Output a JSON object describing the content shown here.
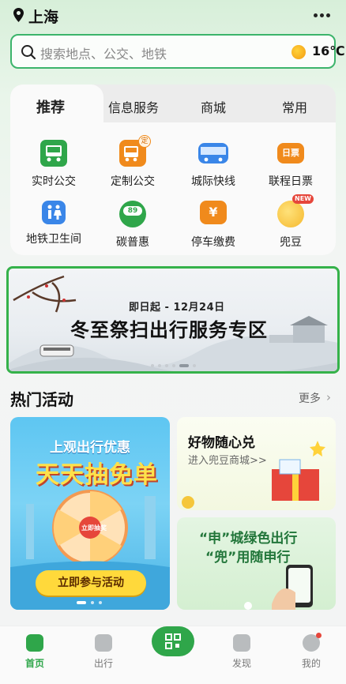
{
  "header": {
    "city": "上海"
  },
  "search": {
    "placeholder": "搜索地点、公交、地铁",
    "temperature": "16℃"
  },
  "panel": {
    "tabs": [
      "推荐",
      "信息服务",
      "商城",
      "常用"
    ],
    "services": [
      {
        "label": "实时公交",
        "icon": "bus-icon",
        "color": "#2fa64a"
      },
      {
        "label": "定制公交",
        "icon": "custom-bus-icon",
        "color": "#f08a1c"
      },
      {
        "label": "城际快线",
        "icon": "intercity-bus-icon",
        "color": "#3a86e8"
      },
      {
        "label": "联程日票",
        "icon": "ticket-icon",
        "color": "#f08a1c"
      },
      {
        "label": "地铁卫生间",
        "icon": "restroom-icon",
        "color": "#3a86e8"
      },
      {
        "label": "碳普惠",
        "icon": "carbon-icon",
        "color": "#2fa64a"
      },
      {
        "label": "停车缴费",
        "icon": "parking-fee-icon",
        "color": "#f08a1c"
      },
      {
        "label": "兜豆",
        "icon": "bean-icon",
        "color": "#f5b82e"
      }
    ],
    "badges": {
      "custom_bus": "定",
      "ticket": "日票",
      "new": "NEW",
      "carbon": "89"
    }
  },
  "banner": {
    "date": "即日起 - 12月24日",
    "title": "冬至祭扫出行服务专区"
  },
  "hot": {
    "title": "热门活动",
    "more": "更多",
    "left_card": {
      "line1": "上观出行优惠",
      "line2": "天天抽免单",
      "button": "立即参与活动",
      "wheel_center": "立即抽奖"
    },
    "right_top": {
      "title": "好物随心兑",
      "subtitle": "进入兜豆商城>>"
    },
    "right_bottom": {
      "line1": "“申”城绿色出行",
      "line2": "“兜”用随申行"
    }
  },
  "nav": {
    "items": [
      {
        "label": "首页",
        "icon": "home-icon"
      },
      {
        "label": "出行",
        "icon": "travel-icon"
      },
      {
        "label": "",
        "icon": "qr-code-icon"
      },
      {
        "label": "发现",
        "icon": "discover-icon"
      },
      {
        "label": "我的",
        "icon": "profile-icon"
      }
    ]
  },
  "colors": {
    "accent": "#2fa64a",
    "border": "#3cb46b"
  }
}
